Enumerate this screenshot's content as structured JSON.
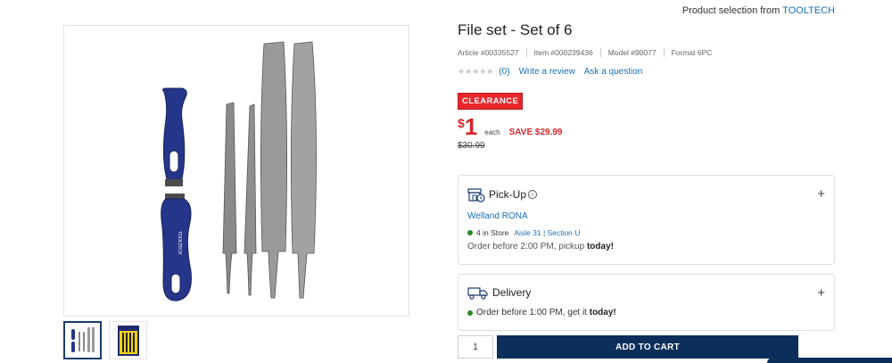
{
  "header": {
    "selection_prefix": "Product selection from",
    "brand": "TOOLTECH"
  },
  "product": {
    "title": "File set - Set of 6",
    "article": "Article #00335527",
    "item": "Item #000239436",
    "model": "Model #90077",
    "format": "Format 6PC",
    "stars": "★★★★★",
    "rating_count": "(0)",
    "write_review": "Write a review",
    "ask_question": "Ask a question",
    "badge": "CLEARANCE",
    "currency": "$",
    "price": "1",
    "unit": "each",
    "save": "SAVE $29.99",
    "was_price": "$30.99"
  },
  "pickup": {
    "label": "Pick-Up",
    "info_glyph": "i",
    "store": "Welland RONA",
    "stock": "4 in Store",
    "aisle": "Aisle 31 | Section U",
    "order_text": "Order before 2:00 PM, pickup",
    "order_strong": "today!"
  },
  "delivery": {
    "label": "Delivery",
    "order_text": "Order before 1:00 PM, get it",
    "order_strong": "today!"
  },
  "expand_glyph": "+",
  "cart": {
    "quantity": "1",
    "add_label": "ADD TO CART"
  },
  "colors": {
    "accent": "#1a6fb4",
    "sale": "#d7262b",
    "cta": "#0b2e5a",
    "in_stock": "#2a8a2a"
  },
  "gallery": {
    "thumbnail_count": 2,
    "active_thumbnail": 1
  }
}
